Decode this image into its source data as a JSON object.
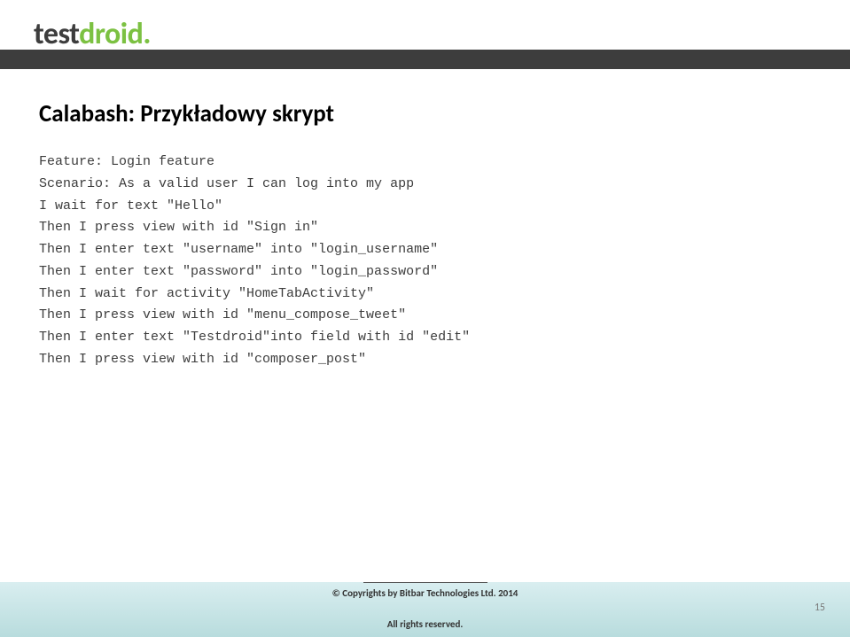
{
  "logo": {
    "part1": "test",
    "part2": "droid",
    "dot": "."
  },
  "title": "Calabash: Przykładowy skrypt",
  "code": {
    "l1": "Feature: Login feature",
    "l2": "Scenario: As a valid user I can log into my app",
    "l3": "I wait for text \"Hello\"",
    "l4": "Then I press view with id \"Sign in\"",
    "l5": "Then I enter text \"username\" into \"login_username\"",
    "l6": "Then I enter text \"password\" into \"login_password\"",
    "l7": "Then I wait for activity \"HomeTabActivity\"",
    "l8": "Then I press view with id \"menu_compose_tweet\"",
    "l9": "Then I enter text \"Testdroid\"into field with id \"edit\"",
    "l10": "Then I press view with id \"composer_post\""
  },
  "footer": {
    "copyright": "© Copyrights by Bitbar Technologies Ltd. 2014",
    "rights": "All rights reserved.",
    "page": "15"
  }
}
